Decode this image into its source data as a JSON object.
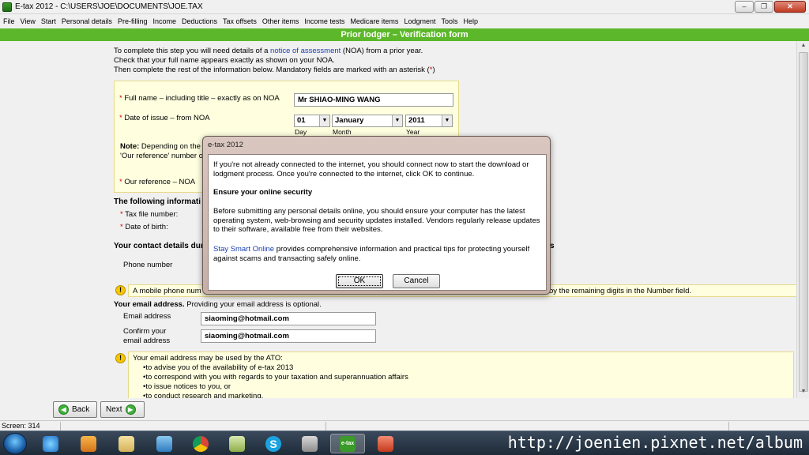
{
  "window": {
    "title": "E-tax 2012 - C:\\USERS\\JOE\\DOCUMENTS\\JOE.TAX"
  },
  "menu": [
    "File",
    "View",
    "Start",
    "Personal details",
    "Pre-filling",
    "Income",
    "Deductions",
    "Tax offsets",
    "Other items",
    "Income tests",
    "Medicare items",
    "Lodgment",
    "Tools",
    "Help"
  ],
  "header": {
    "title": "Prior lodger – Verification form"
  },
  "intro": {
    "line1_pre": "To complete this step you will need details of a ",
    "line1_link": "notice of assessment",
    "line1_post": " (NOA) from a prior year.",
    "line2": "Check that your full name appears exactly as shown on your NOA.",
    "line3_pre": "Then complete the rest of the information below. Mandatory fields are marked with an asterisk (",
    "line3_star": "*",
    "line3_post": ")"
  },
  "noa": {
    "full_name_label": "Full name – including title – exactly as on NOA",
    "full_name_value": "Mr SHIAO-MING WANG",
    "date_label": "Date of issue – from NOA",
    "day": "01",
    "month": "January",
    "year": "2011",
    "day_label": "Day",
    "month_label": "Month",
    "year_label": "Year",
    "note_bold": "Note:",
    "note_text": " Depending on the",
    "note_line2": "'Our reference' number o",
    "ref_label": "Our reference – NOA"
  },
  "following": {
    "heading": "The following informati",
    "tfn_label": "Tax file number:",
    "dob_label": "Date of birth:"
  },
  "contact": {
    "heading": "Your contact details dur",
    "heading_tail": "s",
    "phone_label": "Phone number",
    "mobile_note_start": "A mobile phone num",
    "mobile_note_end": "by the remaining digits in the Number field."
  },
  "email": {
    "heading_bold": "Your email address.",
    "heading_rest": " Providing your email address is optional.",
    "email_label": "Email address",
    "email_value": "siaoming@hotmail.com",
    "confirm_label_1": "Confirm your",
    "confirm_label_2": "email address",
    "confirm_value": "siaoming@hotmail.com",
    "ato_intro": "Your email address may be used by the ATO:",
    "ato_items": [
      "•to advise you of the availability of e-tax 2013",
      "•to correspond with you with regards to your taxation and superannuation affairs",
      "•to issue notices to you, or",
      "•to conduct research and marketing."
    ]
  },
  "nav": {
    "back": "Back",
    "next": "Next"
  },
  "status": {
    "screen": "Screen: 314"
  },
  "dialog": {
    "title": "e-tax 2012",
    "p1": "If you're not already connected to the internet, you should connect now to start the download or lodgment process. Once you're connected to the internet, click OK to continue.",
    "security_heading": "Ensure your online security",
    "p2": "Before submitting any personal details online, you should ensure your computer has the latest operating system, web-browsing and security updates installed. Vendors regularly release updates to their software, available free from their websites.",
    "p3_link": "Stay Smart Online",
    "p3_rest": " provides comprehensive information and practical tips for protecting yourself against scams and transacting safely online.",
    "ok": "OK",
    "cancel": "Cancel"
  },
  "taskbar": {
    "watermark": "http://joenien.pixnet.net/album",
    "active_label": "e-tax"
  },
  "colors": {
    "header_green": "#5cb82a",
    "note_yellow": "#ffffe0",
    "link_blue": "#1a3fb0"
  }
}
